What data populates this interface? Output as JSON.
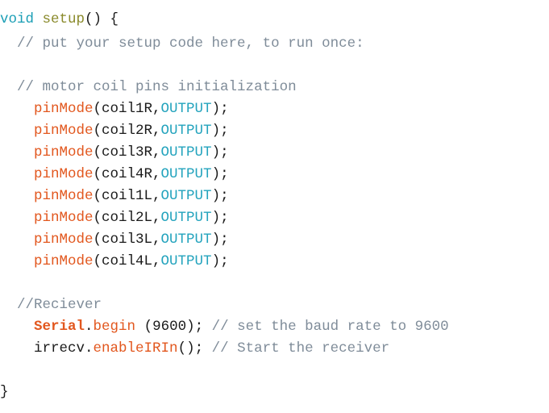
{
  "editor": {
    "title": "Arduino setup() code listing",
    "language": "arduino-cpp",
    "background_color": "#ffffff",
    "font_size_px": 17.5,
    "line_height_px": 27,
    "colors": {
      "keyword": "#1a9eb5",
      "function_name": "#8a8a2b",
      "plain_text": "#1a1a1a",
      "comment": "#7f8c99",
      "function_call": "#e2571e",
      "object_name": "#e2571e",
      "constant": "#23a3bd",
      "number": "#1a1a1a",
      "background": "#ffffff"
    }
  },
  "lines": [
    {
      "id": "line-1",
      "indent": "",
      "tokens": [
        {
          "text": "void",
          "type": "keyword"
        },
        {
          "text": " ",
          "type": "plain"
        },
        {
          "text": "setup",
          "type": "function"
        },
        {
          "text": "() {",
          "type": "plain"
        }
      ]
    },
    {
      "id": "line-2",
      "indent": "  ",
      "tokens": [
        {
          "text": "// put your setup code here, to run once:",
          "type": "comment"
        }
      ]
    },
    {
      "id": "line-3",
      "indent": "",
      "tokens": []
    },
    {
      "id": "line-4",
      "indent": "  ",
      "tokens": [
        {
          "text": "// motor coil pins initialization",
          "type": "comment"
        }
      ]
    },
    {
      "id": "line-5",
      "indent": "    ",
      "tokens": [
        {
          "text": "pinMode",
          "type": "call"
        },
        {
          "text": "(coil1R,",
          "type": "plain"
        },
        {
          "text": "OUTPUT",
          "type": "constant"
        },
        {
          "text": ");",
          "type": "plain"
        }
      ]
    },
    {
      "id": "line-6",
      "indent": "    ",
      "tokens": [
        {
          "text": "pinMode",
          "type": "call"
        },
        {
          "text": "(coil2R,",
          "type": "plain"
        },
        {
          "text": "OUTPUT",
          "type": "constant"
        },
        {
          "text": ");",
          "type": "plain"
        }
      ]
    },
    {
      "id": "line-7",
      "indent": "    ",
      "tokens": [
        {
          "text": "pinMode",
          "type": "call"
        },
        {
          "text": "(coil3R,",
          "type": "plain"
        },
        {
          "text": "OUTPUT",
          "type": "constant"
        },
        {
          "text": ");",
          "type": "plain"
        }
      ]
    },
    {
      "id": "line-8",
      "indent": "    ",
      "tokens": [
        {
          "text": "pinMode",
          "type": "call"
        },
        {
          "text": "(coil4R,",
          "type": "plain"
        },
        {
          "text": "OUTPUT",
          "type": "constant"
        },
        {
          "text": ");",
          "type": "plain"
        }
      ]
    },
    {
      "id": "line-9",
      "indent": "    ",
      "tokens": [
        {
          "text": "pinMode",
          "type": "call"
        },
        {
          "text": "(coil1L,",
          "type": "plain"
        },
        {
          "text": "OUTPUT",
          "type": "constant"
        },
        {
          "text": ");",
          "type": "plain"
        }
      ]
    },
    {
      "id": "line-10",
      "indent": "    ",
      "tokens": [
        {
          "text": "pinMode",
          "type": "call"
        },
        {
          "text": "(coil2L,",
          "type": "plain"
        },
        {
          "text": "OUTPUT",
          "type": "constant"
        },
        {
          "text": ");",
          "type": "plain"
        }
      ]
    },
    {
      "id": "line-11",
      "indent": "    ",
      "tokens": [
        {
          "text": "pinMode",
          "type": "call"
        },
        {
          "text": "(coil3L,",
          "type": "plain"
        },
        {
          "text": "OUTPUT",
          "type": "constant"
        },
        {
          "text": ");",
          "type": "plain"
        }
      ]
    },
    {
      "id": "line-12",
      "indent": "    ",
      "tokens": [
        {
          "text": "pinMode",
          "type": "call"
        },
        {
          "text": "(coil4L,",
          "type": "plain"
        },
        {
          "text": "OUTPUT",
          "type": "constant"
        },
        {
          "text": ");",
          "type": "plain"
        }
      ]
    },
    {
      "id": "line-13",
      "indent": "",
      "tokens": []
    },
    {
      "id": "line-14",
      "indent": "  ",
      "tokens": [
        {
          "text": "//Reciever",
          "type": "comment"
        }
      ]
    },
    {
      "id": "line-15",
      "indent": "    ",
      "tokens": [
        {
          "text": "Serial",
          "type": "object"
        },
        {
          "text": ".",
          "type": "plain"
        },
        {
          "text": "begin",
          "type": "call"
        },
        {
          "text": " (",
          "type": "plain"
        },
        {
          "text": "9600",
          "type": "number"
        },
        {
          "text": "); ",
          "type": "plain"
        },
        {
          "text": "// set the baud rate to 9600",
          "type": "comment"
        }
      ]
    },
    {
      "id": "line-16",
      "indent": "    ",
      "tokens": [
        {
          "text": "irrecv",
          "type": "plain"
        },
        {
          "text": ".",
          "type": "plain"
        },
        {
          "text": "enableIRIn",
          "type": "call"
        },
        {
          "text": "(); ",
          "type": "plain"
        },
        {
          "text": "// Start the receiver",
          "type": "comment"
        }
      ]
    },
    {
      "id": "line-17",
      "indent": "",
      "tokens": []
    },
    {
      "id": "line-18",
      "indent": "",
      "tokens": [
        {
          "text": "}",
          "type": "plain"
        }
      ]
    }
  ]
}
